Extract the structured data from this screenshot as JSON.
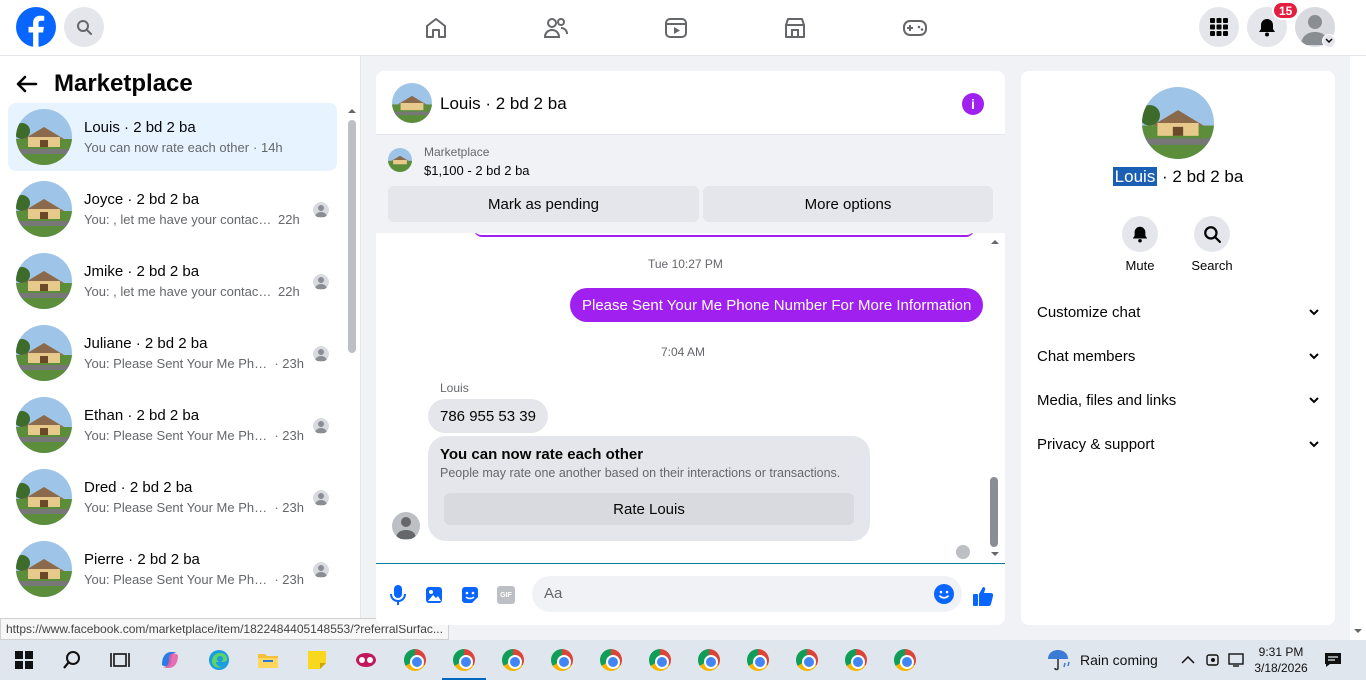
{
  "topbar": {
    "notification_count": "15"
  },
  "left_panel": {
    "title": "Marketplace",
    "conversations": [
      {
        "name": "Louis · 2 bd 2 ba",
        "snippet": "You can now rate each other",
        "time": "· 14h",
        "active": true
      },
      {
        "name": "Joyce · 2 bd 2 ba",
        "snippet": "You: , let me have your contact ...",
        "time": "22h"
      },
      {
        "name": "Jmike · 2 bd 2 ba",
        "snippet": "You: , let me have your contact ...",
        "time": "22h"
      },
      {
        "name": "Juliane · 2 bd 2 ba",
        "snippet": "You: Please Sent Your Me Phone ...",
        "time": "· 23h"
      },
      {
        "name": "Ethan · 2 bd 2 ba",
        "snippet": "You: Please Sent Your Me Phone ...",
        "time": "· 23h"
      },
      {
        "name": "Dred · 2 bd 2 ba",
        "snippet": "You: Please Sent Your Me Phone ...",
        "time": "· 23h"
      },
      {
        "name": "Pierre · 2 bd 2 ba",
        "snippet": "You: Please Sent Your Me Phon...",
        "time": "· 23h"
      }
    ],
    "status_url": "https://www.facebook.com/marketplace/item/1822484405148553/?referralSurfac..."
  },
  "chat": {
    "title": "Louis · 2 bd 2 ba",
    "marketplace_label": "Marketplace",
    "listing": "$1,100 - 2 bd 2 ba",
    "mark_pending": "Mark as pending",
    "more_options": "More options",
    "time1": "Tue 10:27 PM",
    "outgoing": "Please Sent Your Me Phone Number For More Information",
    "time2": "7:04 AM",
    "sender": "Louis",
    "incoming": "786 955 53 39",
    "rate_title": "You can now rate each other",
    "rate_desc": "People may rate one another based on their interactions or transactions.",
    "rate_button": "Rate Louis",
    "input_placeholder": "Aa"
  },
  "details": {
    "name_highlight": "Louis",
    "name_rest": " · 2 bd 2 ba",
    "mute": "Mute",
    "search": "Search",
    "rows": [
      "Customize chat",
      "Chat members",
      "Media, files and links",
      "Privacy & support"
    ]
  },
  "taskbar": {
    "weather": "Rain coming",
    "time": "9:31 PM",
    "date": "3/18/2026"
  },
  "colors": {
    "brand_blue": "#0866ff",
    "purple": "#a020f0",
    "badge_red": "#e41e3f"
  }
}
